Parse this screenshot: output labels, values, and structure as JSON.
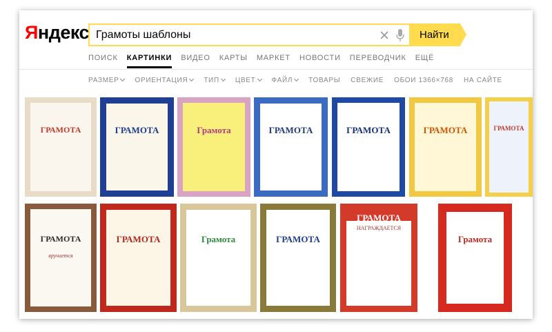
{
  "logo": {
    "text_first": "Я",
    "text_rest": "ндекс"
  },
  "search": {
    "value": "Грамоты шаблоны",
    "button_label": "Найти"
  },
  "nav_tabs": [
    {
      "label": "ПОИСК",
      "active": false
    },
    {
      "label": "КАРТИНКИ",
      "active": true
    },
    {
      "label": "ВИДЕО",
      "active": false
    },
    {
      "label": "КАРТЫ",
      "active": false
    },
    {
      "label": "МАРКЕТ",
      "active": false
    },
    {
      "label": "НОВОСТИ",
      "active": false
    },
    {
      "label": "ПЕРЕВОДЧИК",
      "active": false
    },
    {
      "label": "ЕЩЁ",
      "active": false
    }
  ],
  "filters": [
    {
      "label": "РАЗМЕР",
      "dropdown": true
    },
    {
      "label": "ОРИЕНТАЦИЯ",
      "dropdown": true
    },
    {
      "label": "ТИП",
      "dropdown": true
    },
    {
      "label": "ЦВЕТ",
      "dropdown": true
    },
    {
      "label": "ФАЙЛ",
      "dropdown": true
    },
    {
      "label": "ТОВАРЫ",
      "dropdown": false
    },
    {
      "label": "СВЕЖИЕ",
      "dropdown": false
    },
    {
      "label": "ОБОИ 1366×768",
      "dropdown": false
    },
    {
      "label": "НА САЙТЕ",
      "dropdown": false
    }
  ],
  "thumbnails": [
    {
      "title": "ГРАМОТА",
      "border": "#e8dcc8",
      "bg": "#faf6ee",
      "title_color": "#c0392b"
    },
    {
      "title": "ГРАМОТА",
      "border": "#1f3f95",
      "bg": "#fbf6ea",
      "title_color": "#1d3c8c"
    },
    {
      "title": "Грамота",
      "border": "#d9a4c4",
      "bg": "#f8f07a",
      "title_color": "#b23a84"
    },
    {
      "title": "ГРАМОТА",
      "border": "#3b6ac2",
      "bg": "#ffffff",
      "title_color": "#1f3a7a"
    },
    {
      "title": "ГРАМОТА",
      "border": "#1e4aa6",
      "bg": "#ffffff",
      "title_color": "#152f78"
    },
    {
      "title": "ГРАМОТА",
      "border": "#f2c842",
      "bg": "#fff7d6",
      "title_color": "#d35400"
    },
    {
      "title": "ГРАМОТА",
      "border": "#f3cf4a",
      "bg": "#eef3fb",
      "title_color": "#c0392b"
    },
    {
      "title": "ГРАМОТА",
      "border": "#8a5a3c",
      "bg": "#fbf8f2",
      "title_color": "#2a2a2a",
      "subtitle": "вручается"
    },
    {
      "title": "ГРАМОТА",
      "border": "#c0281e",
      "bg": "#fdf5e6",
      "title_color": "#b3261e"
    },
    {
      "title": "Грамота",
      "border": "#d8c79a",
      "bg": "#ffffff",
      "title_color": "#2d8a3d"
    },
    {
      "title": "ГРАМОТА",
      "border": "#8a7a3a",
      "bg": "#ffffff",
      "title_color": "#1b3a8a"
    },
    {
      "title": "ГРАМОТА",
      "border": "#d33a2a",
      "bg": "#ffffff",
      "title_color": "#ffffff",
      "subtitle": "НАГРАЖДАЕТСЯ"
    },
    {
      "title": "Грамота",
      "border": "#d62a20",
      "bg": "#ffffff",
      "title_color": "#c0281e"
    }
  ],
  "colors": {
    "accent": "#ffdb4d",
    "logo_red": "#ff0000"
  },
  "icons": {
    "clear": "close-icon",
    "mic": "microphone-icon",
    "dropdown": "chevron-down-icon"
  }
}
